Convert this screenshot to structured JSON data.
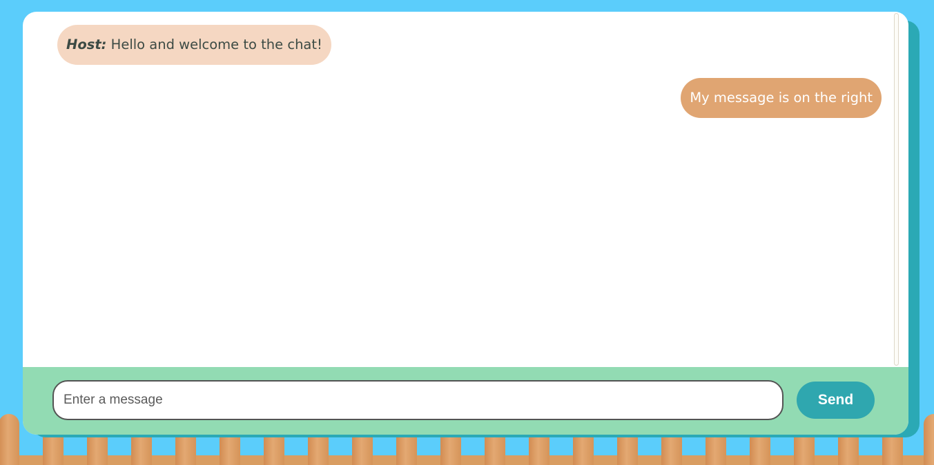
{
  "colors": {
    "sky": "#5bcdfb",
    "window": "#ffffff",
    "window_shadow": "#2ba9b5",
    "input_bar": "#92dbb3",
    "host_bubble": "#f5d7c2",
    "my_bubble": "#e0a572",
    "send_button": "#2fa7af",
    "fence": "#dc9e66"
  },
  "messages": [
    {
      "sender": "Host:",
      "text": "Hello and welcome to the chat!",
      "side": "left"
    },
    {
      "sender": "",
      "text": "My message is on the right",
      "side": "right"
    }
  ],
  "composer": {
    "placeholder": "Enter a message",
    "value": "",
    "send_label": "Send"
  }
}
